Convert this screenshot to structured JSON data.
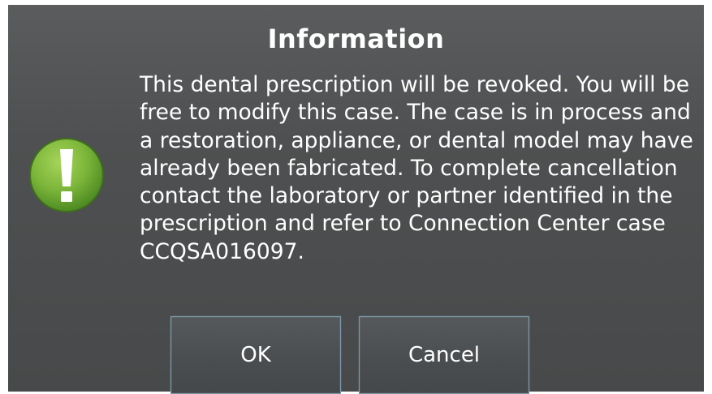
{
  "dialog": {
    "title": "Information",
    "icon": "exclamation-warning-icon",
    "message": "This dental prescription will be revoked. You will be free to modify this case. The case is in process and a restoration, appliance, or dental model may have already been fabricated. To complete cancellation contact the laboratory or partner identified in the prescription and refer to Connection Center case CCQSA016097.",
    "buttons": {
      "ok_label": "OK",
      "cancel_label": "Cancel"
    }
  },
  "colors": {
    "dialog_background": "#4e5051",
    "text": "#ffffff",
    "icon_green": "#7cb63a",
    "button_border": "#7b97aa"
  }
}
